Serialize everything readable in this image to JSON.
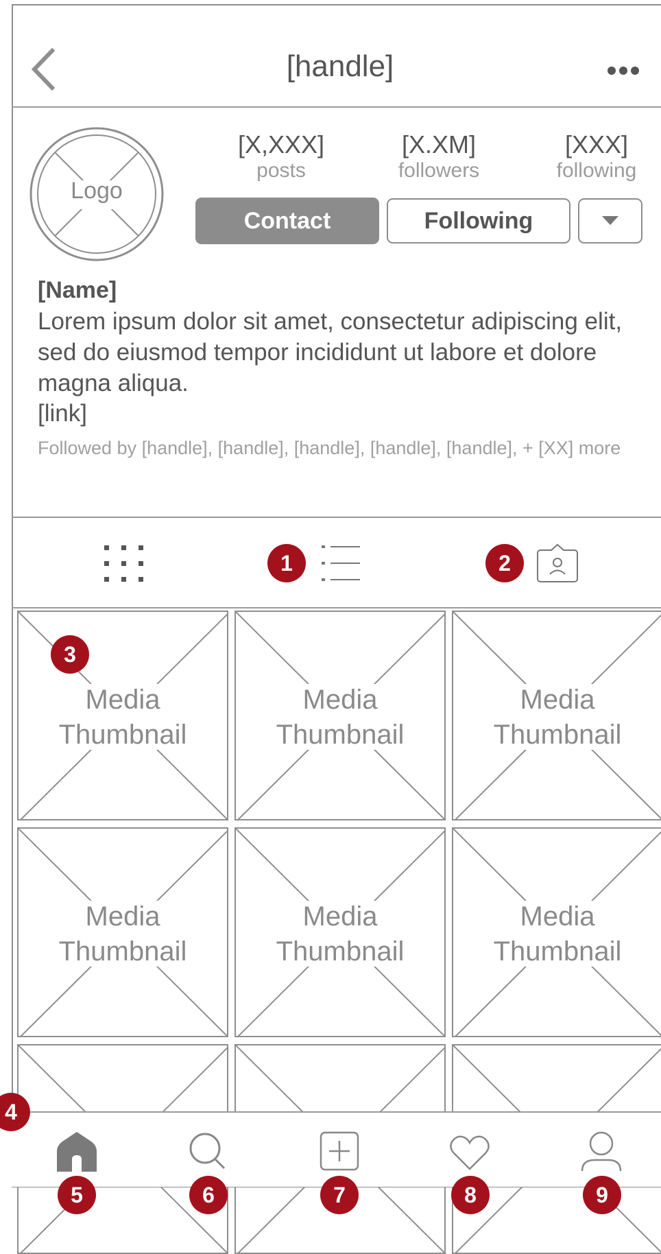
{
  "header": {
    "title": "[handle]",
    "back_icon": "chevron-left-icon",
    "more_icon": "more-dots-icon"
  },
  "profile": {
    "logo_text": "Logo",
    "stats": [
      {
        "value": "[X,XXX]",
        "label": "posts"
      },
      {
        "value": "[X.XM]",
        "label": "followers"
      },
      {
        "value": "[XXX]",
        "label": "following"
      }
    ],
    "contact_label": "Contact",
    "following_label": "Following",
    "dropdown_icon": "caret-down-icon",
    "name": "[Name]",
    "bio": "Lorem ipsum dolor sit amet, consectetur adipiscing elit, sed do eiusmod tempor incididunt ut labore et dolore magna aliqua.",
    "link": "[link]",
    "followed_by": "Followed by [handle], [handle], [handle], [handle], [handle], + [XX] more"
  },
  "tabs": [
    {
      "name": "grid-view-tab",
      "icon": "grid-icon"
    },
    {
      "name": "list-view-tab",
      "icon": "list-icon"
    },
    {
      "name": "tagged-tab",
      "icon": "tagged-person-icon"
    }
  ],
  "media": {
    "thumbnail_line1": "Media",
    "thumbnail_line2": "Thumbnail"
  },
  "bottom_nav": [
    {
      "name": "home",
      "icon": "home-icon"
    },
    {
      "name": "search",
      "icon": "search-icon"
    },
    {
      "name": "create",
      "icon": "add-post-icon"
    },
    {
      "name": "activity",
      "icon": "heart-icon"
    },
    {
      "name": "profile",
      "icon": "user-icon"
    }
  ],
  "annotations": [
    "1",
    "2",
    "3",
    "4",
    "5",
    "6",
    "7",
    "8",
    "9"
  ],
  "colors": {
    "annotation_badge": "#a3121c",
    "wire_gray": "#8e8e8e",
    "button_fill": "#8c8c8c"
  }
}
